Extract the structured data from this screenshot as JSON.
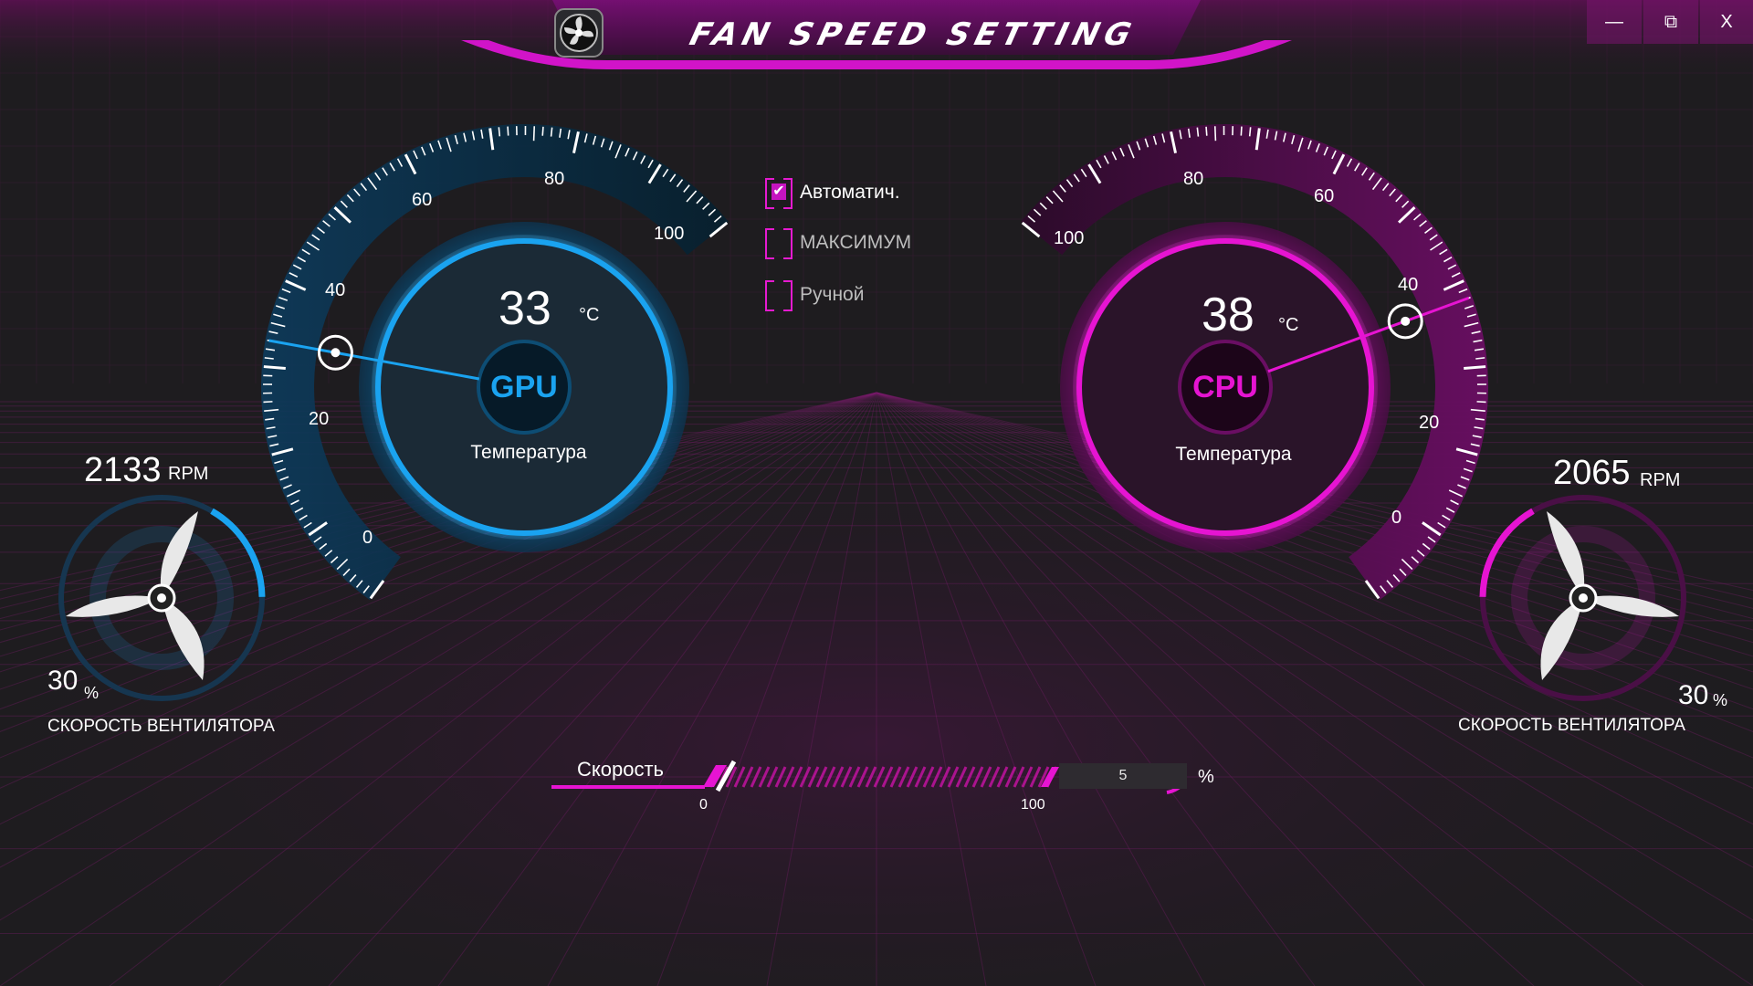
{
  "window": {
    "title": "FAN SPEED SETTING",
    "controls": {
      "minimize": "—",
      "restore": "⧉",
      "close": "X"
    }
  },
  "colors": {
    "gpu_accent": "#1aa3f0",
    "cpu_accent": "#e614d2",
    "background": "#1e1c1f"
  },
  "gpu": {
    "temperature": "33",
    "unit": "°C",
    "chip": "GPU",
    "label": "Температура",
    "scale": [
      "0",
      "20",
      "40",
      "60",
      "80",
      "100"
    ],
    "needle_value": 33,
    "fan": {
      "rpm": "2133",
      "rpm_unit": "RPM",
      "percent": "30",
      "percent_unit": "%",
      "label": "СКОРОСТЬ ВЕНТИЛЯТОРА",
      "level": 0.3
    }
  },
  "cpu": {
    "temperature": "38",
    "unit": "°C",
    "chip": "CPU",
    "label": "Температура",
    "scale": [
      "0",
      "20",
      "40",
      "60",
      "80",
      "100"
    ],
    "needle_value": 38,
    "fan": {
      "rpm": "2065",
      "rpm_unit": "RPM",
      "percent": "30",
      "percent_unit": "%",
      "label": "СКОРОСТЬ ВЕНТИЛЯТОРА",
      "level": 0.3
    }
  },
  "modes": [
    {
      "label": "Автоматич.",
      "checked": true
    },
    {
      "label": "МАКСИМУМ",
      "checked": false
    },
    {
      "label": "Ручной",
      "checked": false
    }
  ],
  "speed": {
    "label": "Скорость",
    "min": "0",
    "max": "100",
    "value": "5",
    "unit": "%"
  }
}
